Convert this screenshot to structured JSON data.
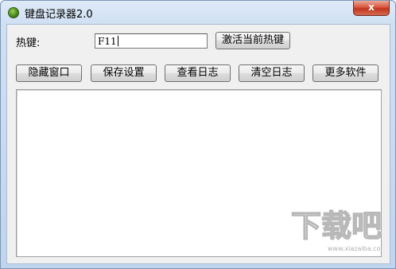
{
  "window": {
    "title": "键盘记录器2.0",
    "close_label": "x"
  },
  "hotkey": {
    "label": "热键:",
    "value": "F11",
    "activate_label": "激活当前热键"
  },
  "toolbar": {
    "hide_window_label": "隐藏窗口",
    "save_settings_label": "保存设置",
    "view_log_label": "查看日志",
    "clear_log_label": "清空日志",
    "more_software_label": "更多软件"
  },
  "log": {
    "content": ""
  },
  "watermark": {
    "text": "下载吧",
    "url": "www.xiazaiba.com"
  }
}
